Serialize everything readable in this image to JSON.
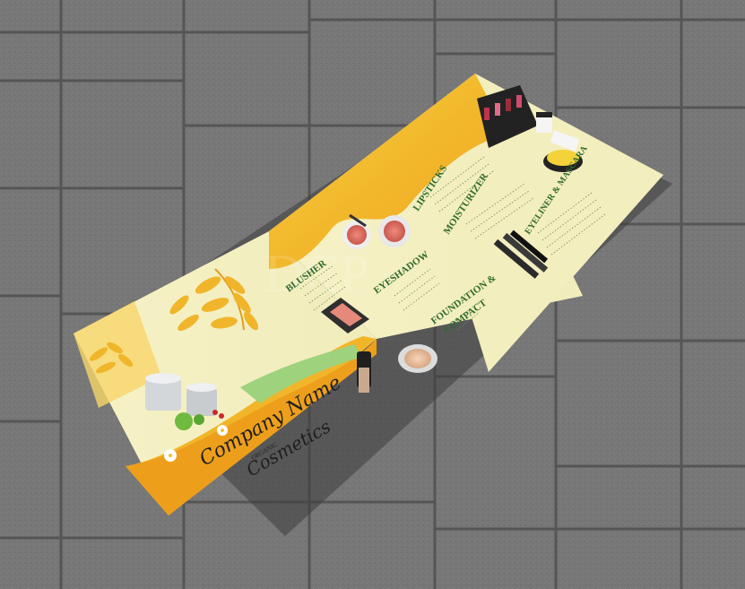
{
  "brochure": {
    "company_name": "Company Name",
    "organic_label": "ORGANIC",
    "cosmetics_label": "Cosmetics",
    "watermark": "DCP"
  },
  "sections": {
    "blusher": "BLUSHER",
    "lipsticks": "LIPSTICKS",
    "eyeshadow": "EYESHADOW",
    "moisturizer": "MOISTURIZER",
    "foundation_line1": "FOUNDATION &",
    "foundation_line2": "COMPACT",
    "eyeliner": "EYELINER & MASCARA"
  },
  "colors": {
    "floor_tile": "#7a7a7a",
    "grout": "#555555",
    "paper_cream": "#f6f2c4",
    "accent_orange": "#f0a923",
    "accent_yellow": "#f5c842",
    "accent_green": "#9ed27a",
    "heading_green": "#2f6b2f"
  }
}
